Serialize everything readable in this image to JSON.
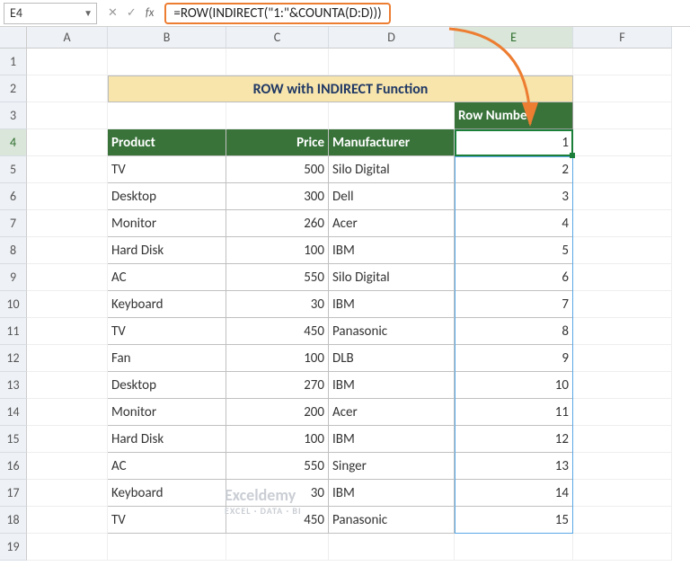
{
  "name_box": "E4",
  "formula": "=ROW(INDIRECT(\"1:\"&COUNTA(D:D)))",
  "cols": [
    "A",
    "B",
    "C",
    "D",
    "E",
    "F"
  ],
  "title": "ROW with INDIRECT Function",
  "headers": {
    "e3": "Row Number",
    "b4": "Product",
    "c4": "Price",
    "d4": "Manufacturer"
  },
  "rows": [
    {
      "n": 1
    },
    {
      "n": 2
    },
    {
      "n": 3,
      "e": ""
    },
    {
      "n": 4,
      "e": "1"
    },
    {
      "n": 5,
      "b": "TV",
      "c": "500",
      "d": "Silo Digital",
      "e": "2"
    },
    {
      "n": 6,
      "b": "Desktop",
      "c": "300",
      "d": "Dell",
      "e": "3"
    },
    {
      "n": 7,
      "b": "Monitor",
      "c": "260",
      "d": "Acer",
      "e": "4"
    },
    {
      "n": 8,
      "b": "Hard Disk",
      "c": "100",
      "d": "IBM",
      "e": "5"
    },
    {
      "n": 9,
      "b": "AC",
      "c": "550",
      "d": "Silo Digital",
      "e": "6"
    },
    {
      "n": 10,
      "b": "Keyboard",
      "c": "30",
      "d": "IBM",
      "e": "7"
    },
    {
      "n": 11,
      "b": "TV",
      "c": "450",
      "d": "Panasonic",
      "e": "8"
    },
    {
      "n": 12,
      "b": "Fan",
      "c": "100",
      "d": "DLB",
      "e": "9"
    },
    {
      "n": 13,
      "b": "Desktop",
      "c": "270",
      "d": "IBM",
      "e": "10"
    },
    {
      "n": 14,
      "b": "Monitor",
      "c": "200",
      "d": "Acer",
      "e": "11"
    },
    {
      "n": 15,
      "b": "Hard Disk",
      "c": "100",
      "d": "IBM",
      "e": "12"
    },
    {
      "n": 16,
      "b": "AC",
      "c": "550",
      "d": "Singer",
      "e": "13"
    },
    {
      "n": 17,
      "b": "Keyboard",
      "c": "30",
      "d": "IBM",
      "e": "14"
    },
    {
      "n": 18,
      "b": "TV",
      "c": "450",
      "d": "Panasonic",
      "e": "15"
    },
    {
      "n": 19
    }
  ],
  "watermark": {
    "main": "Exceldemy",
    "sub": "EXCEL · DATA · BI"
  }
}
